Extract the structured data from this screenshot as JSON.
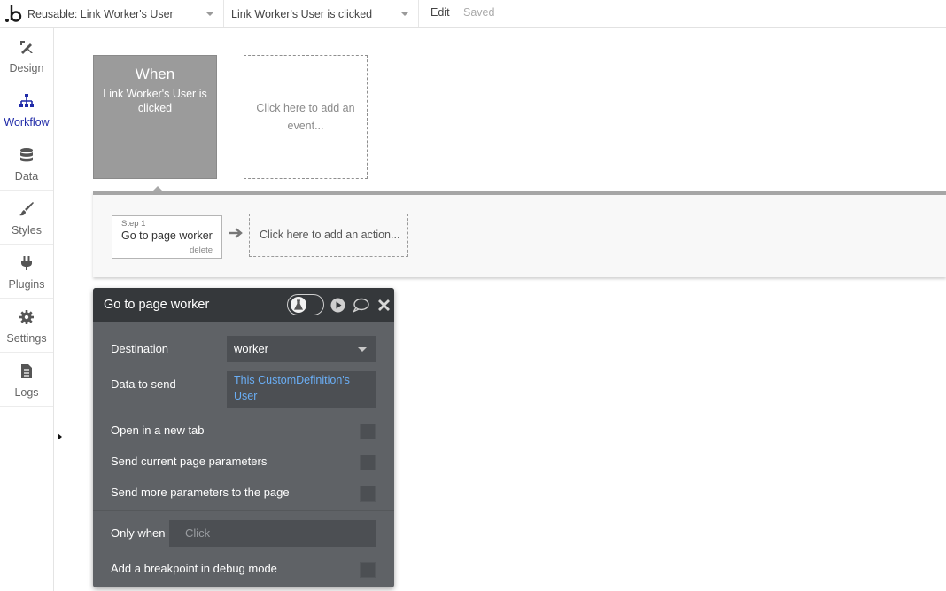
{
  "topbar": {
    "page_select": "Reusable: Link Worker's User",
    "event_select": "Link Worker's User is clicked",
    "edit_label": "Edit",
    "saved_label": "Saved"
  },
  "sidebar": {
    "items": [
      {
        "label": "Design",
        "icon": "design-icon"
      },
      {
        "label": "Workflow",
        "icon": "workflow-icon",
        "active": true
      },
      {
        "label": "Data",
        "icon": "database-icon"
      },
      {
        "label": "Styles",
        "icon": "brush-icon"
      },
      {
        "label": "Plugins",
        "icon": "plug-icon"
      },
      {
        "label": "Settings",
        "icon": "gear-icon"
      },
      {
        "label": "Logs",
        "icon": "document-icon"
      }
    ]
  },
  "workflow": {
    "event_when": "When",
    "event_name": "Link Worker's User is clicked",
    "add_event": "Click here to add an event...",
    "step": {
      "number_label": "Step 1",
      "name": "Go to page worker",
      "delete_label": "delete"
    },
    "add_action": "Click here to add an action..."
  },
  "panel": {
    "title": "Go to page worker",
    "destination_label": "Destination",
    "destination_value": "worker",
    "data_to_send_label": "Data to send",
    "data_to_send_value": "This CustomDefinition's User",
    "open_new_tab_label": "Open in a new tab",
    "send_current_params_label": "Send current page parameters",
    "send_more_params_label": "Send more parameters to the page",
    "only_when_label": "Only when",
    "only_when_placeholder": "Click",
    "breakpoint_label": "Add a breakpoint in debug mode"
  },
  "colors": {
    "accent": "#1f2aa8",
    "event_box": "#9b9b9b",
    "panel_bg": "#5f6266",
    "panel_header": "#35383b",
    "link_blue": "#6aaef5"
  }
}
